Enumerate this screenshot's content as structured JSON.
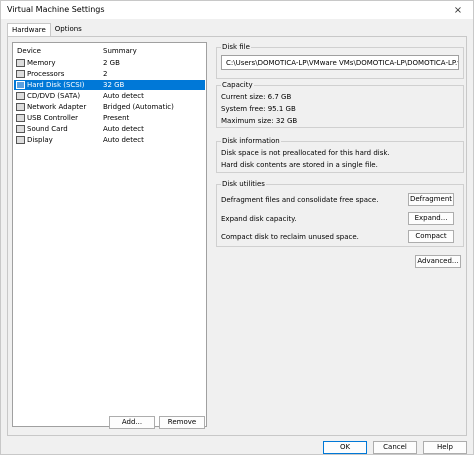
{
  "window": {
    "title": "Virtual Machine Settings",
    "close_glyph": "×"
  },
  "tabs": [
    {
      "label": "Hardware"
    },
    {
      "label": "Options"
    }
  ],
  "device_list": {
    "col_device": "Device",
    "col_summary": "Summary",
    "items": [
      {
        "name": "Memory",
        "summary": "2 GB"
      },
      {
        "name": "Processors",
        "summary": "2"
      },
      {
        "name": "Hard Disk (SCSI)",
        "summary": "32 GB"
      },
      {
        "name": "CD/DVD (SATA)",
        "summary": "Auto detect"
      },
      {
        "name": "Network Adapter",
        "summary": "Bridged (Automatic)"
      },
      {
        "name": "USB Controller",
        "summary": "Present"
      },
      {
        "name": "Sound Card",
        "summary": "Auto detect"
      },
      {
        "name": "Display",
        "summary": "Auto detect"
      }
    ],
    "selected_index": 2
  },
  "list_buttons": {
    "add": "Add...",
    "remove": "Remove"
  },
  "disk_file": {
    "label": "Disk file",
    "path": "C:\\Users\\DOMOTICA-LP\\VMware VMs\\DOMOTICA-LP\\DOMOTICA-LP.vmdk"
  },
  "capacity": {
    "label": "Capacity",
    "current": "Current size:  6.7 GB",
    "system_free": "System free:  95.1 GB",
    "maximum": "Maximum size:  32 GB"
  },
  "disk_info": {
    "label": "Disk information",
    "line1": "Disk space is not preallocated for this hard disk.",
    "line2": "Hard disk contents are stored in a single file."
  },
  "disk_utilities": {
    "label": "Disk utilities",
    "defrag_text": "Defragment files and consolidate free space.",
    "defrag_btn": "Defragment",
    "expand_text": "Expand disk capacity.",
    "expand_btn": "Expand...",
    "compact_text": "Compact disk to reclaim unused space.",
    "compact_btn": "Compact"
  },
  "advanced_btn": "Advanced...",
  "footer": {
    "ok": "OK",
    "cancel": "Cancel",
    "help": "Help"
  },
  "colors": {
    "selection": "#0078d7",
    "window_bg": "#f0f0f0"
  }
}
